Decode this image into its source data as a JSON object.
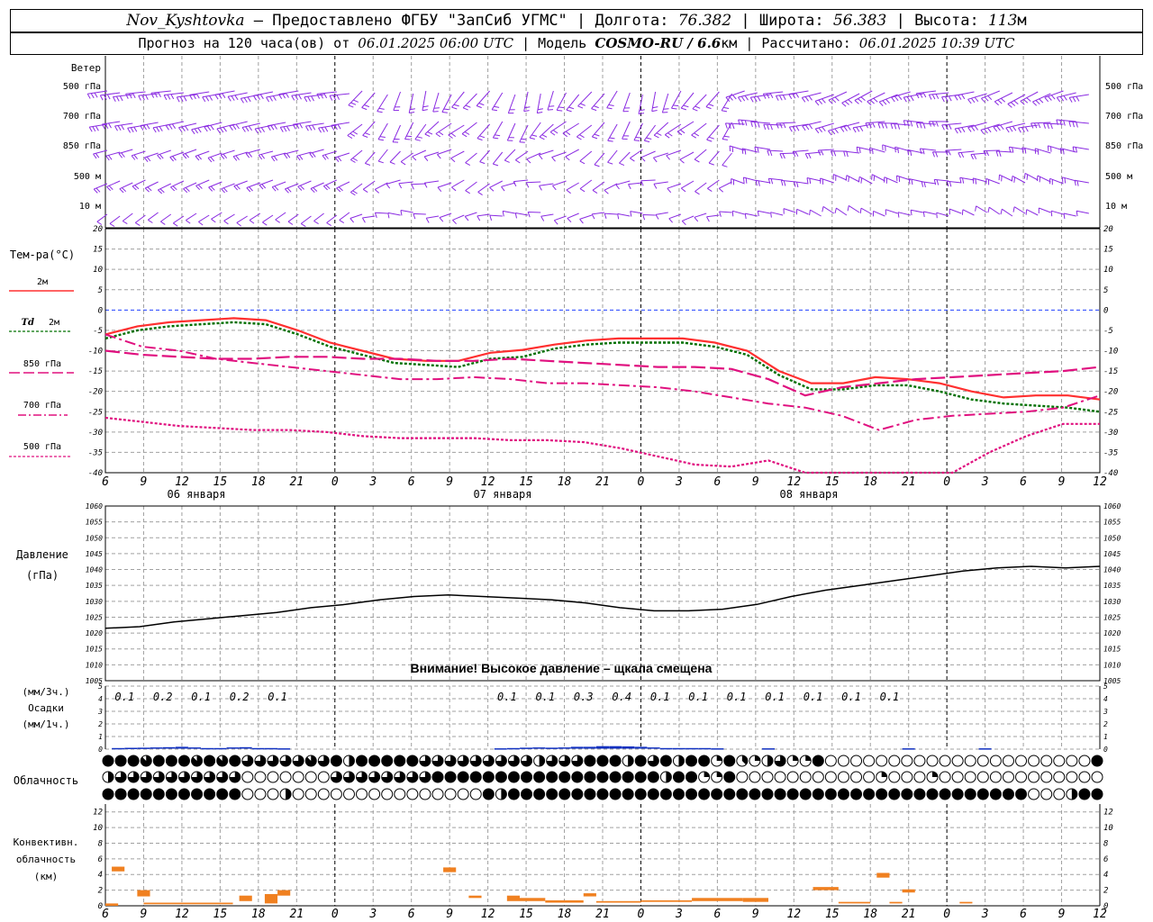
{
  "header": {
    "station": "Nov_Kyshtovka",
    "dash": "—",
    "provider": "Предоставлено ФГБУ \"ЗапСиб УГМС\"",
    "lon_label": "Долгота:",
    "lon": "76.382",
    "lat_label": "Широта:",
    "lat": "56.383",
    "alt_label": "Высота:",
    "alt": "113",
    "alt_unit": "м",
    "sep": "|"
  },
  "subheader": {
    "forecast_prefix": "Прогноз на 120 часа(ов) от",
    "issue_time": "06.01.2025 06:00 UTC",
    "model_label": "Модель",
    "model": "COSMO-RU / 6.6",
    "model_unit": "км",
    "calc_label": "Рассчитано:",
    "calc_time": "06.01.2025 10:39 UTC",
    "sep": "|"
  },
  "colors": {
    "wind": "#8a2be2",
    "t2m": "#ff3030",
    "td2m": "#007000",
    "levels": "#e0107f",
    "pressure": "#000000",
    "precip": "#1030c0",
    "conv": "#f08020",
    "grid": "#a0a0a0",
    "zero": "#2040ff"
  },
  "time_axis": {
    "ticks": [
      "6",
      "9",
      "12",
      "15",
      "18",
      "21",
      "0",
      "3",
      "6",
      "9",
      "12",
      "15",
      "18",
      "21",
      "0",
      "3",
      "6",
      "9",
      "12",
      "15",
      "18",
      "21",
      "0",
      "3",
      "6",
      "9",
      "12"
    ],
    "days": [
      "06 января",
      "07 января",
      "08 января"
    ]
  },
  "wind_panel": {
    "title": "Ветер",
    "levels": [
      "500 гПа",
      "700 гПа",
      "850 гПа",
      "500 м",
      "10  м"
    ]
  },
  "chart_data": [
    {
      "type": "line",
      "title": "Тем-ра(°C)",
      "ylim": [
        -40,
        20
      ],
      "yticks": [
        20,
        15,
        10,
        5,
        0,
        -5,
        -10,
        -15,
        -20,
        -25,
        -30,
        -35,
        -40
      ],
      "x_hours": [
        0,
        3,
        6,
        9,
        12,
        15,
        18,
        21,
        24,
        27,
        30,
        33,
        36,
        39,
        42,
        45,
        48,
        51,
        54,
        57,
        60,
        63,
        66,
        69,
        72,
        75,
        78
      ],
      "series": [
        {
          "name": "2м",
          "values": [
            -6,
            -4,
            -3,
            -2.5,
            -2,
            -2.5,
            -5,
            -8,
            -10,
            -12,
            -12.5,
            -12.5,
            -10.5,
            -9.8,
            -8.5,
            -7.5,
            -7,
            -7,
            -7,
            -8,
            -10,
            -15,
            -18,
            -18,
            -16.5,
            -17,
            -18,
            -20,
            -21.5,
            -21,
            -21,
            -22
          ]
        },
        {
          "name": "Td 2м",
          "values": [
            -7,
            -5,
            -4,
            -3.5,
            -3,
            -3.5,
            -6,
            -9,
            -11,
            -13,
            -13.5,
            -14,
            -12,
            -11.5,
            -9.5,
            -8.5,
            -8,
            -8,
            -8,
            -9,
            -11,
            -16,
            -19.5,
            -19.5,
            -18.5,
            -18.5,
            -20,
            -22,
            -23,
            -23.5,
            -24,
            -25
          ]
        },
        {
          "name": "850 гПа",
          "values": [
            -10,
            -11,
            -11.5,
            -12,
            -12,
            -11.5,
            -11.5,
            -12,
            -12,
            -12.5,
            -12.5,
            -12,
            -12.5,
            -13,
            -13.5,
            -14,
            -14,
            -14.5,
            -17,
            -21,
            -19,
            -18,
            -17,
            -16.5,
            -16,
            -15.5,
            -15,
            -14
          ]
        },
        {
          "name": "700 гПа",
          "values": [
            -6,
            -9,
            -10,
            -12,
            -13,
            -14,
            -15,
            -16,
            -17,
            -17,
            -16.5,
            -17,
            -18,
            -18,
            -18.5,
            -19,
            -20,
            -21.5,
            -23,
            -24,
            -26,
            -29.5,
            -27,
            -26,
            -25.5,
            -25,
            -24,
            -21
          ]
        },
        {
          "name": "500 гПа",
          "values": [
            -26.5,
            -27.5,
            -28.5,
            -29,
            -29.5,
            -29.5,
            -30,
            -31,
            -31.5,
            -31.5,
            -31.5,
            -32,
            -32,
            -32.5,
            -34,
            -36,
            -38,
            -38.5,
            -37,
            -40,
            -44,
            -48,
            -45,
            -40,
            -35,
            -31,
            -28,
            -28
          ]
        }
      ]
    },
    {
      "type": "line",
      "title": "Давление",
      "ylabel": "(гПа)",
      "ylim": [
        1005,
        1060
      ],
      "yticks": [
        1060,
        1055,
        1050,
        1045,
        1040,
        1035,
        1030,
        1025,
        1020,
        1015,
        1010,
        1005
      ],
      "x_hours": [
        0,
        3,
        6,
        9,
        12,
        15,
        18,
        21,
        24,
        27,
        30,
        33,
        36,
        39,
        42,
        45,
        48,
        51,
        54,
        57,
        60,
        63,
        66,
        69,
        72,
        75,
        78
      ],
      "series": [
        {
          "name": "Давление",
          "values": [
            1021.5,
            1022,
            1023.5,
            1024.5,
            1025.5,
            1026.5,
            1028,
            1029,
            1030.5,
            1031.5,
            1032,
            1031.5,
            1031,
            1030.5,
            1029.5,
            1028,
            1027,
            1027,
            1027.5,
            1029,
            1031.5,
            1033.5,
            1035,
            1036.5,
            1038,
            1039.5,
            1040.5,
            1041,
            1040.5,
            1041
          ]
        }
      ],
      "note": "Внимание! Высокое давление – щкала смещена"
    },
    {
      "type": "bar",
      "title": "Осадки",
      "ylabel_3h": "(мм/3ч.)",
      "ylabel_1h": "(мм/1ч.)",
      "ylim": [
        0,
        5
      ],
      "yticks": [
        5,
        4,
        3,
        2,
        1,
        0
      ],
      "labels_x_hours": [
        1.5,
        4.5,
        7.5,
        10.5,
        13.5,
        31.5,
        34.5,
        37.5,
        40.5,
        43.5,
        46.5,
        49.5,
        52.5,
        55.5,
        58.5,
        61.5
      ],
      "labels": [
        "0.1",
        "0.2",
        "0.1",
        "0.2",
        "0.1",
        "0.1",
        "0.1",
        "0.3",
        "0.4",
        "0.1",
        "0.1",
        "0.1",
        "0.1",
        "0.1",
        "0.1",
        "0.1"
      ],
      "hourly_x_hours": [
        1,
        2,
        3,
        4,
        5,
        6,
        7,
        8,
        9,
        10,
        11,
        12,
        13,
        14,
        31,
        32,
        33,
        34,
        35,
        36,
        37,
        38,
        39,
        40,
        41,
        42,
        43,
        44,
        45,
        46,
        47,
        48,
        52,
        63,
        69
      ],
      "hourly_values": [
        0.05,
        0.07,
        0.08,
        0.1,
        0.12,
        0.15,
        0.1,
        0.05,
        0.05,
        0.1,
        0.12,
        0.05,
        0.05,
        0.03,
        0.03,
        0.05,
        0.08,
        0.1,
        0.08,
        0.1,
        0.15,
        0.15,
        0.2,
        0.2,
        0.18,
        0.15,
        0.1,
        0.05,
        0.05,
        0.05,
        0.05,
        0.03,
        0.03,
        0.03,
        0.03
      ]
    },
    {
      "type": "table",
      "title": "Облачность",
      "note": "coverage in eighths for low / middle / high rows, hourly",
      "rows": [
        [
          8,
          8,
          8,
          7,
          8,
          8,
          8,
          7,
          8,
          7,
          8,
          6,
          6,
          6,
          6,
          6,
          7,
          6,
          8,
          4,
          8,
          8,
          8,
          8,
          8,
          6,
          6,
          6,
          6,
          6,
          6,
          6,
          6,
          6,
          4,
          6,
          6,
          6,
          8,
          8,
          8,
          4,
          8,
          6,
          8,
          4,
          8,
          8,
          2,
          8,
          3,
          2,
          4,
          6,
          2,
          2,
          8,
          0,
          0,
          0,
          0,
          0,
          0,
          0,
          0,
          0,
          0,
          0,
          0,
          0,
          0,
          0,
          0,
          0,
          0,
          0,
          0,
          0,
          8
        ],
        [
          4,
          6,
          6,
          6,
          6,
          6,
          6,
          6,
          6,
          6,
          6,
          0,
          0,
          0,
          0,
          0,
          0,
          0,
          6,
          6,
          6,
          6,
          6,
          6,
          6,
          6,
          8,
          8,
          8,
          8,
          8,
          8,
          8,
          8,
          8,
          8,
          8,
          8,
          8,
          8,
          8,
          8,
          8,
          8,
          4,
          8,
          8,
          2,
          2,
          8,
          0,
          0,
          0,
          0,
          0,
          0,
          0,
          0,
          0,
          0,
          0,
          2,
          0,
          0,
          0,
          2,
          0,
          0,
          0,
          0,
          0,
          0,
          0,
          0,
          0,
          0,
          0,
          0,
          0
        ],
        [
          8,
          8,
          8,
          8,
          8,
          8,
          8,
          8,
          8,
          8,
          8,
          0,
          0,
          0,
          4,
          0,
          0,
          0,
          0,
          0,
          0,
          0,
          0,
          0,
          0,
          0,
          0,
          0,
          0,
          0,
          8,
          4,
          8,
          8,
          8,
          8,
          8,
          8,
          8,
          8,
          8,
          8,
          8,
          8,
          8,
          8,
          8,
          8,
          8,
          8,
          8,
          8,
          8,
          8,
          8,
          8,
          8,
          8,
          8,
          8,
          8,
          8,
          8,
          8,
          8,
          8,
          8,
          8,
          8,
          8,
          8,
          8,
          8,
          0,
          0,
          0,
          4,
          8,
          8
        ]
      ]
    },
    {
      "type": "bar",
      "title": "Конвективн. облачность",
      "ylabel": "(км)",
      "ylim": [
        0,
        13
      ],
      "yticks": [
        12,
        10,
        8,
        6,
        4,
        2,
        0
      ],
      "segments": [
        {
          "x0": 0,
          "x1": 1,
          "base": 0,
          "top": 0.3
        },
        {
          "x0": 0.5,
          "x1": 1.5,
          "base": 4.4,
          "top": 5.0
        },
        {
          "x0": 2.5,
          "x1": 3.5,
          "base": 1.2,
          "top": 2.0
        },
        {
          "x0": 3,
          "x1": 10,
          "base": 0.2,
          "top": 0.4
        },
        {
          "x0": 10.5,
          "x1": 11.5,
          "base": 0.6,
          "top": 1.3
        },
        {
          "x0": 12.5,
          "x1": 13.5,
          "base": 0.3,
          "top": 1.5
        },
        {
          "x0": 13.5,
          "x1": 14.5,
          "base": 1.3,
          "top": 2.0
        },
        {
          "x0": 26.5,
          "x1": 27.5,
          "base": 4.3,
          "top": 4.9
        },
        {
          "x0": 28.5,
          "x1": 29.5,
          "base": 1.0,
          "top": 1.3
        },
        {
          "x0": 31.5,
          "x1": 32.5,
          "base": 0.6,
          "top": 1.3
        },
        {
          "x0": 32.5,
          "x1": 34.5,
          "base": 0.6,
          "top": 1.0
        },
        {
          "x0": 34.5,
          "x1": 37.5,
          "base": 0.4,
          "top": 0.7
        },
        {
          "x0": 37.5,
          "x1": 38.5,
          "base": 1.2,
          "top": 1.6
        },
        {
          "x0": 38.5,
          "x1": 42,
          "base": 0.4,
          "top": 0.6
        },
        {
          "x0": 42,
          "x1": 46,
          "base": 0.5,
          "top": 0.7
        },
        {
          "x0": 46,
          "x1": 50,
          "base": 0.6,
          "top": 1.0
        },
        {
          "x0": 50,
          "x1": 52,
          "base": 0.5,
          "top": 1.0
        },
        {
          "x0": 55.5,
          "x1": 57.5,
          "base": 2.0,
          "top": 2.4
        },
        {
          "x0": 57.5,
          "x1": 60,
          "base": 0.3,
          "top": 0.5
        },
        {
          "x0": 60.5,
          "x1": 61.5,
          "base": 3.6,
          "top": 4.2
        },
        {
          "x0": 61.5,
          "x1": 62.5,
          "base": 0.3,
          "top": 0.5
        },
        {
          "x0": 62.5,
          "x1": 63.5,
          "base": 1.7,
          "top": 2.1
        },
        {
          "x0": 67,
          "x1": 68,
          "base": 0.3,
          "top": 0.5
        }
      ]
    }
  ],
  "legend": {
    "temp_title": "Тем-ра(°C)",
    "t2m": "2м",
    "td_prefix": "Td",
    "td": "2м",
    "l850": "850 гПа",
    "l700": "700 гПа",
    "l500": "500 гПа"
  },
  "pressure_panel": {
    "title": "Давление",
    "unit": "(гПа)",
    "note": "Внимание! Высокое давление – щкала смещена"
  },
  "precip_panel": {
    "unit3": "(мм/3ч.)",
    "title": "Осадки",
    "unit1": "(мм/1ч.)"
  },
  "cloud_panel": {
    "title": "Облачность"
  },
  "conv_panel": {
    "title1": "Конвективн.",
    "title2": "облачность",
    "unit": "(км)"
  }
}
